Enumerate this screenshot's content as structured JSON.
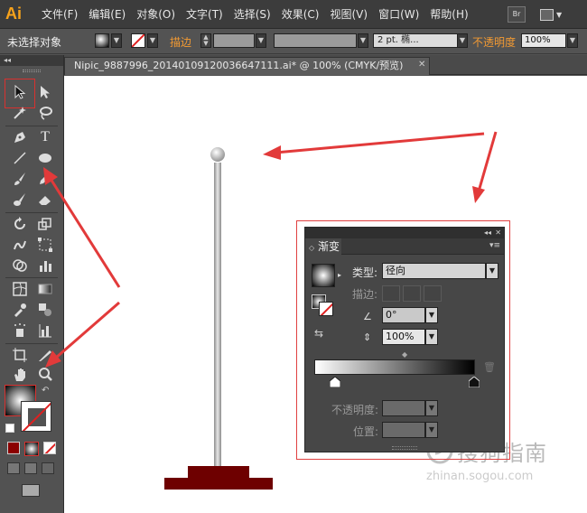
{
  "app": {
    "logo": "Ai"
  },
  "menu": [
    "文件(F)",
    "编辑(E)",
    "对象(O)",
    "文字(T)",
    "选择(S)",
    "效果(C)",
    "视图(V)",
    "窗口(W)",
    "帮助(H)"
  ],
  "bridge_label": "Br",
  "control": {
    "selection": "未选择对象",
    "stroke_label": "描边",
    "brush": "2 pt. 椭...",
    "opacity_label": "不透明度",
    "opacity_value": "100%"
  },
  "toolbox_collapse": "◂◂",
  "document_tab": {
    "title": "Nipic_9887996_20140109120036647111.ai*  @  100% (CMYK/预览)",
    "close": "✕"
  },
  "gradient_panel": {
    "collapse": "◂◂",
    "close": "✕",
    "tab_arrows": "◇",
    "tab": "渐变",
    "type_label": "类型:",
    "type_value": "径向",
    "stroke_label": "描边:",
    "angle_value": "0°",
    "aspect_value": "100%",
    "opacity_label": "不透明度:",
    "location_label": "位置:"
  },
  "watermark": {
    "text": "搜狗指南",
    "url": "zhinan.sogou.com"
  },
  "colors": {
    "accent": "#f29a33",
    "highlight": "#e04040",
    "base": "#6e0000",
    "logo": "#f7a21b"
  }
}
